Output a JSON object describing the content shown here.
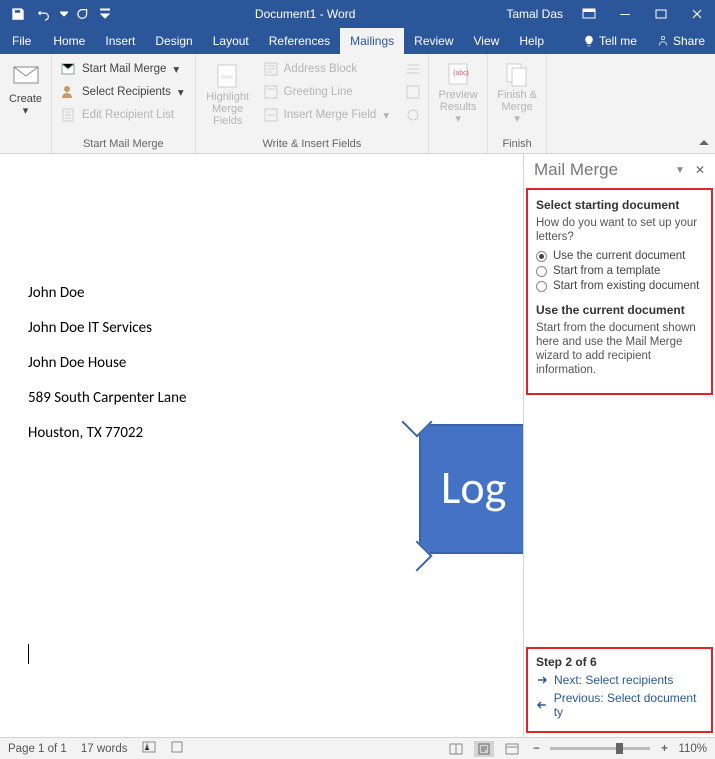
{
  "title": "Document1 - Word",
  "user": "Tamal Das",
  "tabs": {
    "file": "File",
    "home": "Home",
    "insert": "Insert",
    "design": "Design",
    "layout": "Layout",
    "references": "References",
    "mailings": "Mailings",
    "review": "Review",
    "view": "View",
    "help": "Help",
    "tellme": "Tell me",
    "share": "Share"
  },
  "ribbon": {
    "create": "Create",
    "start_mail_merge": "Start Mail Merge",
    "select_recipients": "Select Recipients",
    "edit_recipient_list": "Edit Recipient List",
    "group_start": "Start Mail Merge",
    "highlight": "Highlight Merge Fields",
    "address_block": "Address Block",
    "greeting_line": "Greeting Line",
    "insert_merge_field": "Insert Merge Field",
    "group_write": "Write & Insert Fields",
    "preview": "Preview Results",
    "finish": "Finish & Merge",
    "group_finish": "Finish"
  },
  "document": {
    "lines": [
      "John Doe",
      "John Doe IT Services",
      "John Doe House",
      "589 South Carpenter Lane",
      "Houston, TX 77022"
    ],
    "logo_text": "Log"
  },
  "pane": {
    "title": "Mail Merge",
    "sec1_heading": "Select starting document",
    "sec1_q": "How do you want to set up your letters?",
    "opt1": "Use the current document",
    "opt2": "Start from a template",
    "opt3": "Start from existing document",
    "sec2_heading": "Use the current document",
    "sec2_body": "Start from the document shown here and use the Mail Merge wizard to add recipient information.",
    "step": "Step 2 of 6",
    "next": "Next: Select recipients",
    "prev": "Previous: Select document ty"
  },
  "status": {
    "page": "Page 1 of 1",
    "words": "17 words",
    "zoom": "110%"
  }
}
